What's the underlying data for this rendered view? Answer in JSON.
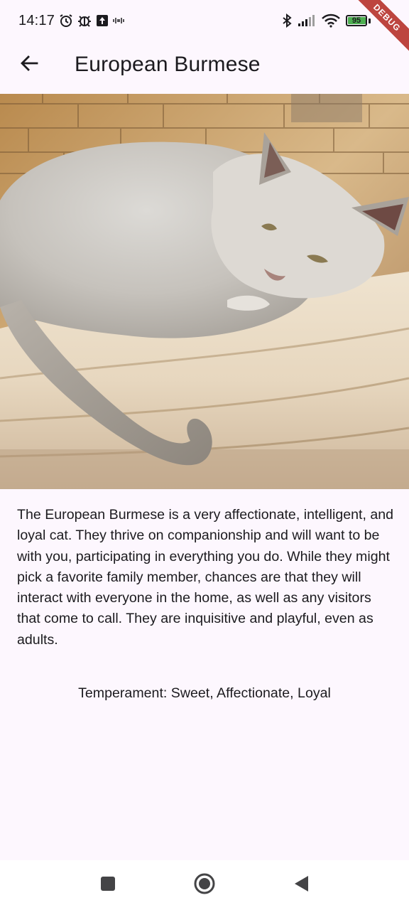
{
  "status_bar": {
    "time": "14:17",
    "battery_level": "95",
    "battery_fraction": 0.95,
    "left_icons": [
      "alarm-icon",
      "bug-icon",
      "upload-icon",
      "vibrate-icon"
    ],
    "right_icons": [
      "bluetooth-icon",
      "signal-icon",
      "wifi-icon",
      "battery-icon"
    ]
  },
  "debug_banner": {
    "label": "DEBUG"
  },
  "app_bar": {
    "back_icon": "arrow-left-icon",
    "title": "European Burmese"
  },
  "hero_image": {
    "subject": "cat-photo"
  },
  "body": {
    "description": "The European Burmese is a very affectionate, intelligent, and loyal cat. They thrive on companionship and will want to be with you, participating in everything you do. While they might pick a favorite family member, chances are that they will interact with everyone in the home, as well as any visitors that come to call. They are inquisitive and playful, even as adults.",
    "temperament": "Temperament: Sweet, Affectionate, Loyal"
  },
  "navigation_bar": {
    "buttons": [
      "recents-button",
      "home-button",
      "back-button"
    ]
  },
  "colors": {
    "background": "#fdf7fe",
    "text": "#1c1b1f",
    "battery_green": "#4caf50",
    "debug_red": "#b3261e"
  }
}
